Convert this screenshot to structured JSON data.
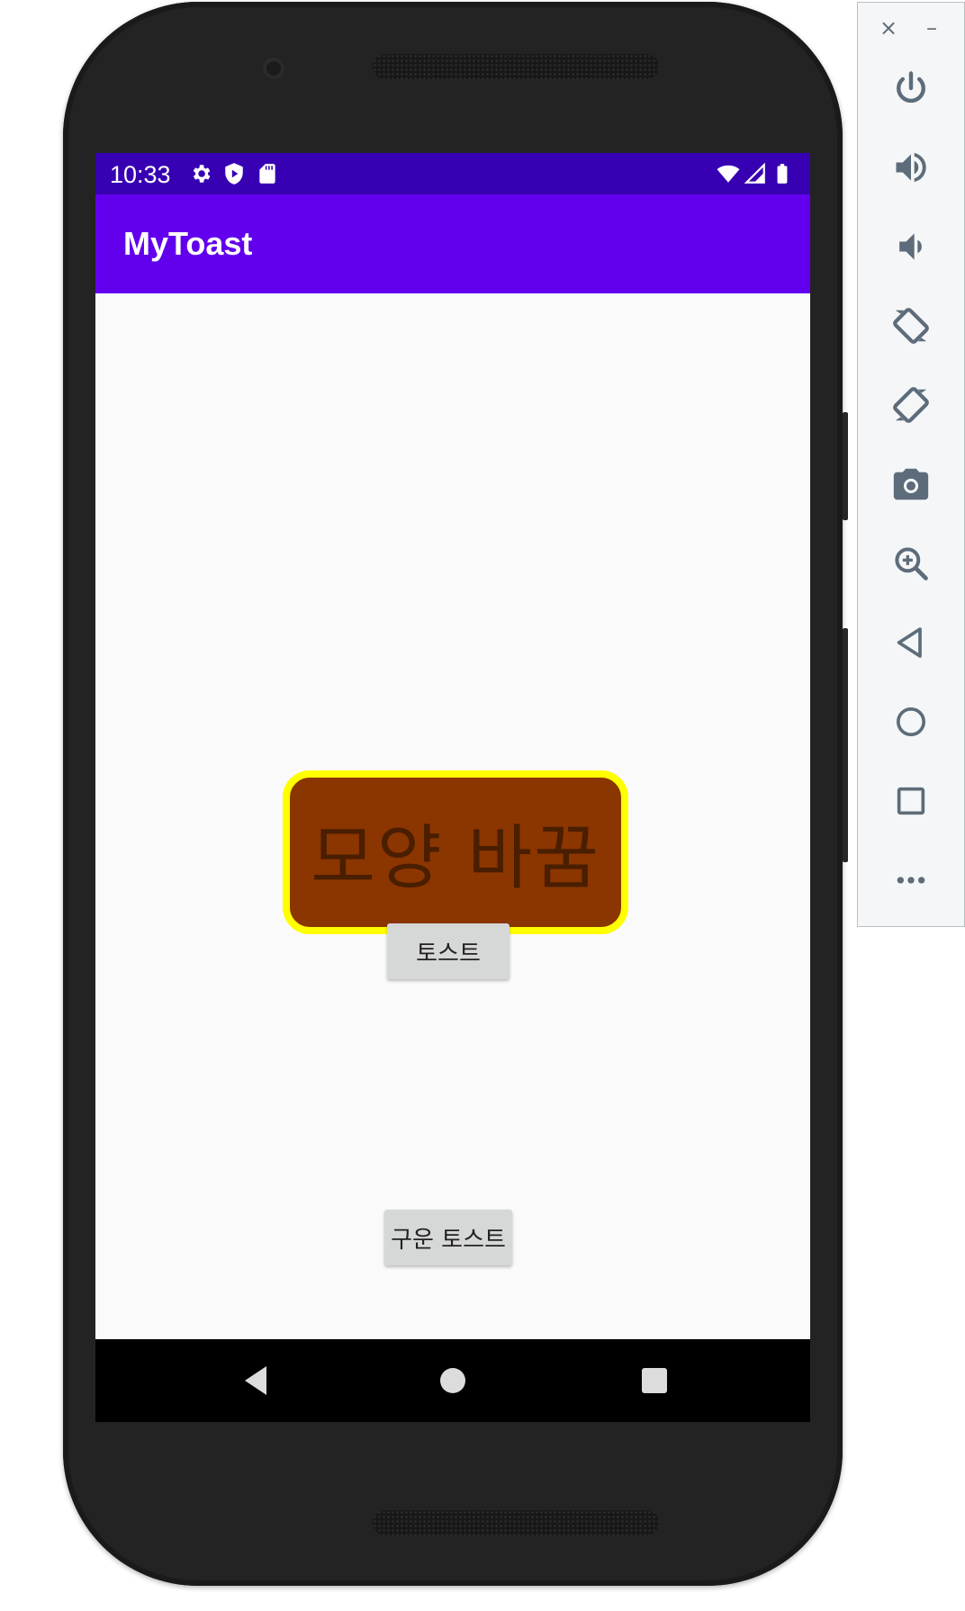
{
  "status_bar": {
    "time": "10:33",
    "left_icons": [
      "settings-icon",
      "shield-play-icon",
      "sd-card-icon"
    ],
    "right_icons": [
      "wifi-icon",
      "cellular-signal-icon",
      "battery-icon"
    ],
    "background": "#3700b3"
  },
  "app_bar": {
    "title": "MyToast",
    "background": "#6200ee"
  },
  "main": {
    "custom_toast": {
      "text": "모양 바꿈",
      "background": "#8b3500",
      "border_color": "#ffff00"
    },
    "toast_button": {
      "label": "토스트"
    },
    "baked_toast_button": {
      "label": "구운 토스트"
    }
  },
  "nav_bar": {
    "buttons": [
      "back-icon",
      "home-icon",
      "recents-icon"
    ]
  },
  "emulator_panel": {
    "window_controls": {
      "close": "×",
      "minimize": "–"
    },
    "buttons": [
      "power-icon",
      "volume-up-icon",
      "volume-down-icon",
      "rotate-left-icon",
      "rotate-right-icon",
      "camera-icon",
      "zoom-icon",
      "back-icon",
      "home-icon",
      "overview-icon",
      "more-icon"
    ]
  }
}
